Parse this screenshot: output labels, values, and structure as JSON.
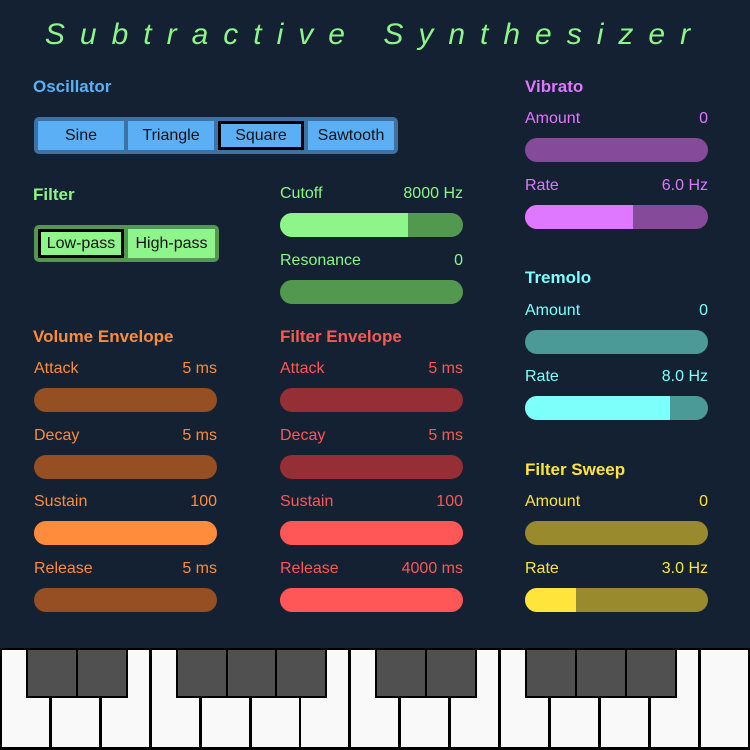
{
  "title": "Subtractive Synthesizer",
  "colors": {
    "background": "#132133",
    "title": "#8ef58a",
    "oscillator": "#5bb0f5",
    "filter": "#8ef58a",
    "volume_env": "#ff8c3b",
    "filter_env": "#ff5757",
    "vibrato": "#df78ff",
    "tremolo": "#7dfffb",
    "sweep": "#ffe53b"
  },
  "oscillator": {
    "label": "Oscillator",
    "options": [
      "Sine",
      "Triangle",
      "Square",
      "Sawtooth"
    ],
    "selected": "Square"
  },
  "filter": {
    "label": "Filter",
    "options": [
      "Low-pass",
      "High-pass"
    ],
    "selected": "Low-pass",
    "cutoff": {
      "label": "Cutoff",
      "value": "8000 Hz",
      "fraction": 0.7
    },
    "resonance": {
      "label": "Resonance",
      "value": "0",
      "fraction": 0
    }
  },
  "volume_envelope": {
    "label": "Volume Envelope",
    "attack": {
      "label": "Attack",
      "value": "5 ms",
      "fraction": 0
    },
    "decay": {
      "label": "Decay",
      "value": "5 ms",
      "fraction": 0
    },
    "sustain": {
      "label": "Sustain",
      "value": "100",
      "fraction": 1
    },
    "release": {
      "label": "Release",
      "value": "5 ms",
      "fraction": 0
    }
  },
  "filter_envelope": {
    "label": "Filter Envelope",
    "attack": {
      "label": "Attack",
      "value": "5 ms",
      "fraction": 0
    },
    "decay": {
      "label": "Decay",
      "value": "5 ms",
      "fraction": 0
    },
    "sustain": {
      "label": "Sustain",
      "value": "100",
      "fraction": 1
    },
    "release": {
      "label": "Release",
      "value": "4000 ms",
      "fraction": 1
    }
  },
  "vibrato": {
    "label": "Vibrato",
    "amount": {
      "label": "Amount",
      "value": "0",
      "fraction": 0
    },
    "rate": {
      "label": "Rate",
      "value": "6.0 Hz",
      "fraction": 0.59
    }
  },
  "tremolo": {
    "label": "Tremolo",
    "amount": {
      "label": "Amount",
      "value": "0",
      "fraction": 0
    },
    "rate": {
      "label": "Rate",
      "value": "8.0 Hz",
      "fraction": 0.79
    }
  },
  "filter_sweep": {
    "label": "Filter Sweep",
    "amount": {
      "label": "Amount",
      "value": "0",
      "fraction": 0
    },
    "rate": {
      "label": "Rate",
      "value": "3.0 Hz",
      "fraction": 0.28
    }
  },
  "keyboard": {
    "white_keys": 15,
    "black_key_after_white": [
      0,
      1,
      3,
      4,
      5,
      7,
      8,
      10,
      11,
      12
    ]
  }
}
